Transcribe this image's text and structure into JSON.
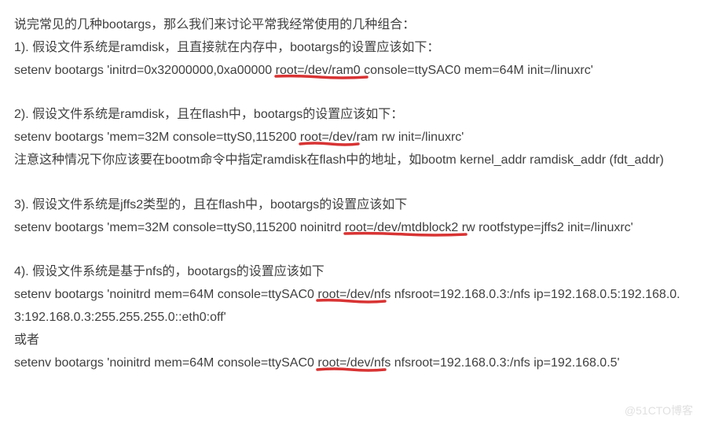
{
  "intro": "说完常见的几种bootargs，那么我们来讨论平常我经常使用的几种组合：",
  "section1": {
    "heading": "1). 假设文件系统是ramdisk，且直接就在内存中，bootargs的设置应该如下：",
    "cmd_pre": "setenv bootargs 'initrd=0x32000000,0xa00000 ",
    "cmd_ul": "root=/dev/ram0",
    "cmd_post": " console=ttySAC0 mem=64M init=/linuxrc'"
  },
  "section2": {
    "heading": "2). 假设文件系统是ramdisk，且在flash中，bootargs的设置应该如下：",
    "cmd_pre": "setenv bootargs 'mem=32M console=ttyS0,115200 ",
    "cmd_ul": "root=/dev/",
    "cmd_post": "ram rw init=/linuxrc'",
    "note": "注意这种情况下你应该要在bootm命令中指定ramdisk在flash中的地址，如bootm kernel_addr ramdisk_addr (fdt_addr)"
  },
  "section3": {
    "heading": "3). 假设文件系统是jffs2类型的，且在flash中，bootargs的设置应该如下",
    "cmd_pre": "setenv bootargs 'mem=32M console=ttyS0,115200 noinitrd ",
    "cmd_ul": "root=/dev/mtdblock2",
    "cmd_post": " rw rootfstype=jffs2 init=/linuxrc'"
  },
  "section4": {
    "heading": "4). 假设文件系统是基于nfs的，bootargs的设置应该如下",
    "cmd1_pre": "setenv bootargs 'noinitrd mem=64M console=ttySAC0 ",
    "cmd1_ul": "root=/dev/n",
    "cmd1_post": "fs nfsroot=192.168.0.3:/nfs ip=192.168.0.5:192.168.0.3:192.168.0.3:255.255.255.0::eth0:off'",
    "or": "或者",
    "cmd2_pre": "setenv bootargs 'noinitrd mem=64M console=ttySAC0 ",
    "cmd2_ul": "root=/dev/n",
    "cmd2_post": "fs nfsroot=192.168.0.3:/nfs ip=192.168.0.5'"
  },
  "watermark": "@51CTO博客"
}
